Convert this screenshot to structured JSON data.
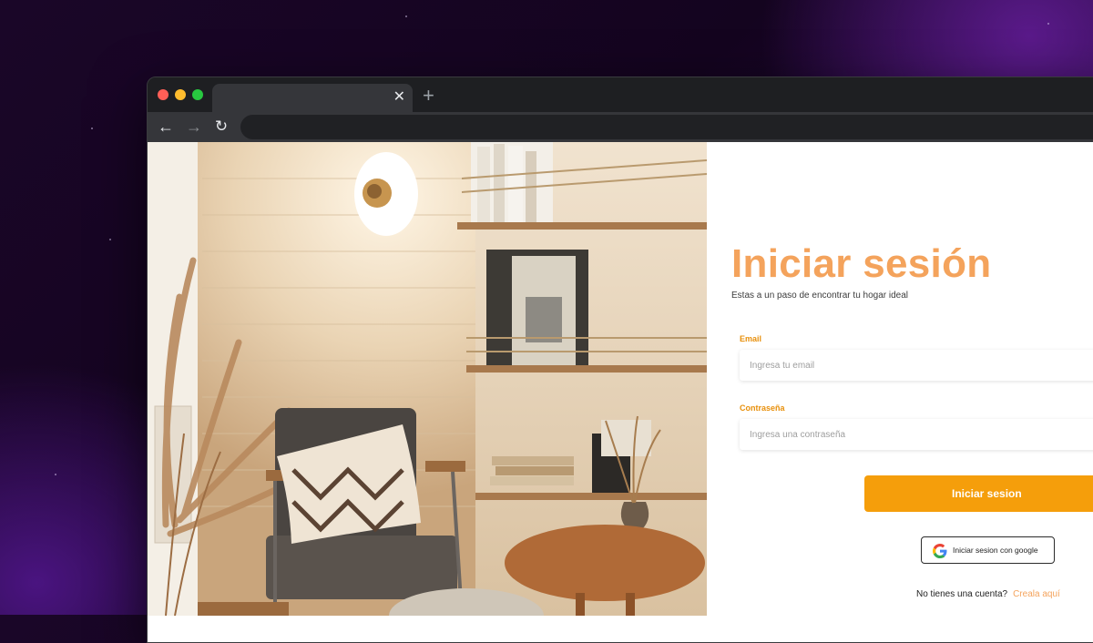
{
  "browser": {
    "tab_close_glyph": "✕",
    "new_tab_glyph": "+",
    "back_glyph": "←",
    "forward_glyph": "→",
    "reload_glyph": "↻"
  },
  "login": {
    "title": "Iniciar sesión",
    "subtitle": "Estas a un paso de encontrar tu hogar ideal",
    "email_label": "Email",
    "email_placeholder": "Ingresa tu email",
    "email_value": "",
    "password_label": "Contraseña",
    "password_placeholder": "Ingresa una contraseña",
    "password_value": "",
    "submit_label": "Iniciar sesion",
    "google_label": "Iniciar sesion con google",
    "signup_prompt": "No tienes una cuenta?",
    "signup_link": "Creala aquí"
  },
  "colors": {
    "accent": "#f4a35c",
    "button": "#f59e0b",
    "label": "#e8900c"
  },
  "icons": [
    "close-icon",
    "plus-icon",
    "back-arrow-icon",
    "forward-arrow-icon",
    "reload-icon",
    "google-icon"
  ]
}
